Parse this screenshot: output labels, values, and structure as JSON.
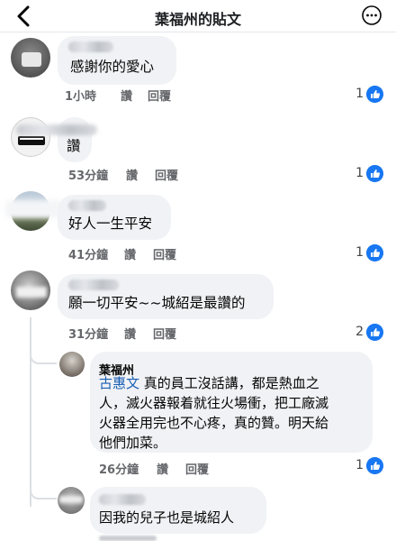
{
  "header": {
    "title": "葉福州的貼文"
  },
  "comments": [
    {
      "text": "感謝你的愛心",
      "time": "1小時",
      "like_label": "讚",
      "reply_label": "回覆",
      "reactions": "1"
    },
    {
      "text": "讚",
      "time": "53分鐘",
      "like_label": "讚",
      "reply_label": "回覆",
      "reactions": "1"
    },
    {
      "text": "好人一生平安",
      "time": "41分鐘",
      "like_label": "讚",
      "reply_label": "回覆",
      "reactions": "1"
    },
    {
      "text": "願一切平安~~城紹是最讚的",
      "time": "31分鐘",
      "like_label": "讚",
      "reply_label": "回覆",
      "reactions": "2"
    }
  ],
  "replies": [
    {
      "author": "葉福州",
      "mention": "古惠文",
      "lines": [
        "真的員工沒話講，都是熱血之",
        "人，滅火器報着就往火場衝，把工廠滅",
        "火器全用完也不心疼，真的贊。明天給",
        "他們加菜。"
      ],
      "time": "26分鐘",
      "like_label": "讚",
      "reply_label": "回覆",
      "reactions": "1"
    },
    {
      "text": "因我的兒子也是城紹人"
    }
  ],
  "colors": {
    "like_blue": "#1877f2",
    "bubble_bg": "#f0f2f5",
    "mention_blue": "#1a5fb4"
  }
}
